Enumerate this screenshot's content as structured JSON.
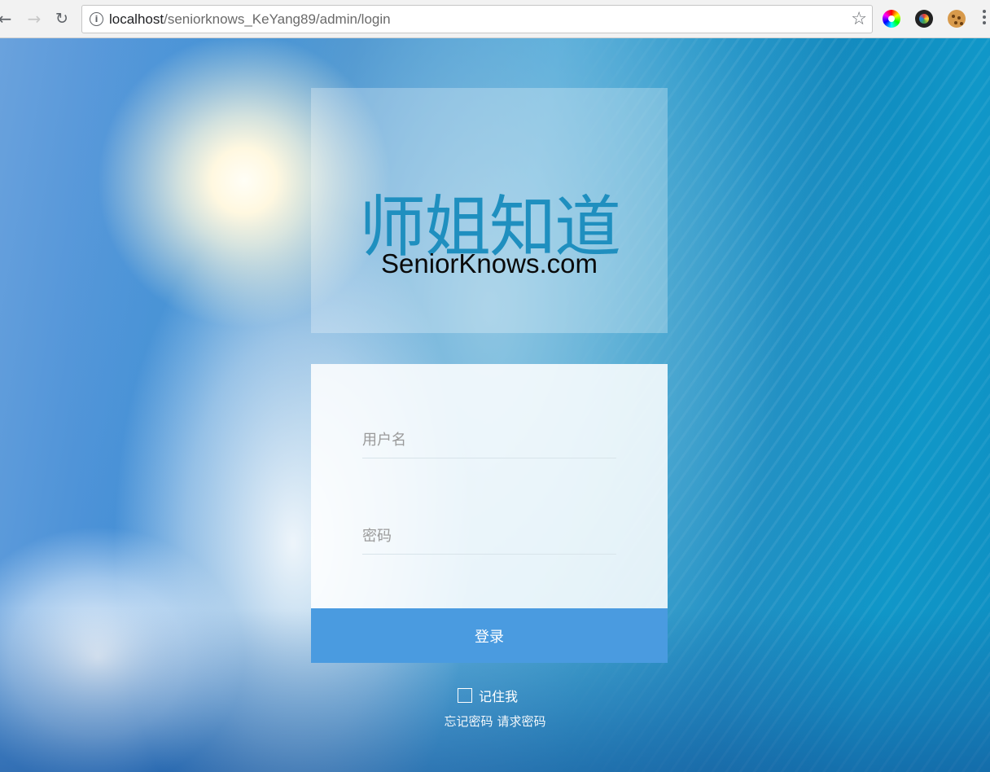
{
  "browser": {
    "url_host": "localhost",
    "url_path": "/seniorknows_KeYang89/admin/login",
    "info_icon": "i",
    "star_icon": "☆",
    "back_icon": "←",
    "forward_icon": "→",
    "reload_icon": "↻"
  },
  "brand": {
    "title_cn": "师姐知道",
    "title_en": "SeniorKnows.com"
  },
  "form": {
    "username_placeholder": "用户名",
    "password_placeholder": "密码",
    "login_label": "登录",
    "remember_label": "记住我",
    "forgot_label": "忘记密码",
    "request_label": "请求密码"
  },
  "colors": {
    "login_button": "#4a9be0",
    "brand_text": "#1f8fbf"
  }
}
